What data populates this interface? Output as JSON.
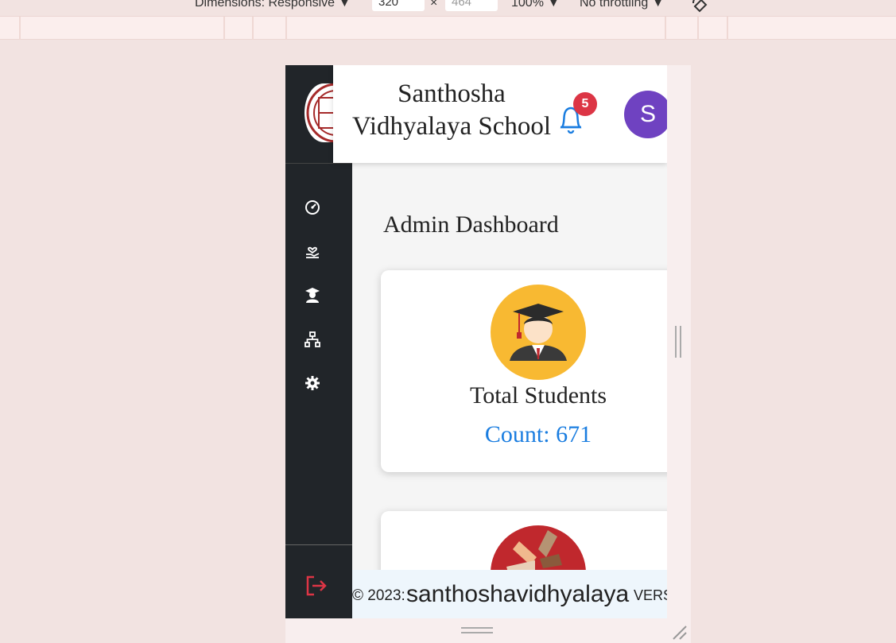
{
  "devtools": {
    "dimensions_label": "Dimensions: Responsive ▼",
    "width_value": "320",
    "times": "×",
    "height_value": "464",
    "zoom": "100% ▼",
    "throttle": "No throttling ▼"
  },
  "header": {
    "school_name_line1": "Santhosha",
    "school_name_line2": "Vidhyalaya School",
    "notification_count": "5",
    "avatar_initial": "S"
  },
  "sidebar": {
    "items": [
      {
        "icon": "dashboard-icon"
      },
      {
        "icon": "hand-heart-icon"
      },
      {
        "icon": "graduate-icon"
      },
      {
        "icon": "hierarchy-icon"
      },
      {
        "icon": "gear-icon"
      }
    ],
    "logout_icon": "logout-icon"
  },
  "main": {
    "title": "Admin Dashboard",
    "cards": [
      {
        "label": "Total Students",
        "count": "Count: 671",
        "icon": "graduate-student-icon",
        "icon_bg": "#f8b932"
      },
      {
        "icon": "teamwork-hands-icon",
        "icon_bg": "#c0282d"
      }
    ]
  },
  "footer": {
    "copyright": "© 2023:",
    "site": "santhoshavidhyalaya",
    "version": "VERS"
  },
  "colors": {
    "sidebar": "#212529",
    "accent_count": "#1a7de0",
    "badge": "#dc3545",
    "avatar": "#6f42c1",
    "logout": "#dc3545"
  }
}
